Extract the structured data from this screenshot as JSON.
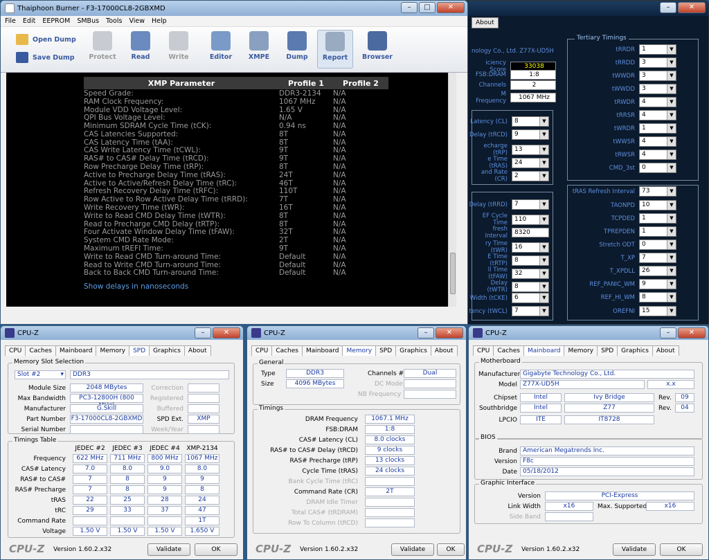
{
  "tp": {
    "title": "Thaiphoon Burner - F3-17000CL8-2GBXMD",
    "menu": [
      "File",
      "Edit",
      "EEPROM",
      "SMBus",
      "Tools",
      "View",
      "Help"
    ],
    "open_dump": "Open Dump",
    "save_dump": "Save Dump",
    "buttons": [
      "Protect",
      "Read",
      "Write",
      "Editor",
      "XMPE",
      "Dump",
      "Report",
      "Browser"
    ],
    "headers": [
      "XMP Parameter",
      "Profile 1",
      "Profile 2"
    ],
    "rows": [
      [
        "Speed Grade:",
        "DDR3-2134",
        "N/A"
      ],
      [
        "RAM Clock Frequency:",
        "1067 MHz",
        "N/A"
      ],
      [
        "Module VDD Voltage Level:",
        "1.65 V",
        "N/A"
      ],
      [
        "QPI Bus Voltage Level:",
        "N/A",
        "N/A"
      ],
      [
        "Minimum SDRAM Cycle Time (tCK):",
        "0.94 ns",
        "N/A"
      ],
      [
        "CAS Latencies Supported:",
        "8T",
        "N/A"
      ],
      [
        "CAS Latency Time (tAA):",
        "8T",
        "N/A"
      ],
      [
        "CAS Write Latency Time (tCWL):",
        "9T",
        "N/A"
      ],
      [
        "RAS# to CAS# Delay Time (tRCD):",
        "9T",
        "N/A"
      ],
      [
        "Row Precharge Delay Time (tRP):",
        "8T",
        "N/A"
      ],
      [
        "Active to Precharge Delay Time (tRAS):",
        "24T",
        "N/A"
      ],
      [
        "Active to Active/Refresh Delay Time (tRC):",
        "46T",
        "N/A"
      ],
      [
        "Refresh Recovery Delay Time (tRFC):",
        "110T",
        "N/A"
      ],
      [
        "Row Active to Row Active Delay Time (tRRD):",
        "7T",
        "N/A"
      ],
      [
        "Write Recovery Time (tWR):",
        "16T",
        "N/A"
      ],
      [
        "Write to Read CMD Delay Time (tWTR):",
        "8T",
        "N/A"
      ],
      [
        "Read to Precharge CMD Delay (tRTP):",
        "8T",
        "N/A"
      ],
      [
        "Four Activate Window Delay Time (tFAW):",
        "32T",
        "N/A"
      ],
      [
        "System CMD Rate Mode:",
        "2T",
        "N/A"
      ],
      [
        "Maximum tREFI Time:",
        "9T",
        "N/A"
      ],
      [
        "Write to Read CMD Turn-around Time:",
        "Default",
        "N/A"
      ],
      [
        "Read to Write CMD Turn-around Time:",
        "Default",
        "N/A"
      ],
      [
        "Back to Back CMD Turn-around Time:",
        "Default",
        "N/A"
      ]
    ],
    "link": "Show delays in nanoseconds"
  },
  "dk": {
    "tab": "About",
    "co": "nology Co., Ltd.  Z77X-UD5H",
    "info": [
      [
        "iciency Score",
        "33038"
      ],
      [
        "FSB:DRAM",
        "1:8"
      ],
      [
        "Channels",
        "2"
      ],
      [
        "M Frequency",
        "1067 MHz"
      ]
    ],
    "primary": [
      [
        "Latency (CL)",
        "8"
      ],
      [
        "Delay (tRCD)",
        "9"
      ],
      [
        "echarge (tRP)",
        "13"
      ],
      [
        "e Time (tRAS)",
        "24"
      ],
      [
        "and Rate (CR)",
        "2"
      ]
    ],
    "secondary": [
      [
        "Delay (tRRD)",
        "7"
      ],
      [
        "EF Cycle Time",
        "110"
      ],
      [
        "fresh Interval",
        "8320"
      ],
      [
        "ry Time (tWR)",
        "16"
      ],
      [
        "E Time (tRTP)",
        "8"
      ],
      [
        "ll Time (tFAW)",
        "32"
      ],
      [
        "Delay (tWTR)",
        "8"
      ],
      [
        "Width (tCKE)",
        "6"
      ],
      [
        "tency (tWCL)",
        "7"
      ]
    ],
    "tert_caption": "Tertiary Timings",
    "tertiary": [
      [
        "tRRDR",
        "1"
      ],
      [
        "tRRDD",
        "3"
      ],
      [
        "tWWDR",
        "3"
      ],
      [
        "tWWDD",
        "3"
      ],
      [
        "tRWDR",
        "4"
      ],
      [
        "tRRSR",
        "4"
      ],
      [
        "tWRDR",
        "1"
      ],
      [
        "tWWSR",
        "4"
      ],
      [
        "tRWSR",
        "4"
      ],
      [
        "CMD_3st",
        "0"
      ]
    ],
    "misc": [
      [
        "tRAS Refresh Interval",
        "73"
      ],
      [
        "TAONPD",
        "10"
      ],
      [
        "TCPDED",
        "1"
      ],
      [
        "TPREPDEN",
        "1"
      ],
      [
        "Stretch ODT",
        "0"
      ],
      [
        "T_XP",
        "7"
      ],
      [
        "T_XPDLL",
        "26"
      ],
      [
        "REF_PANIC_WM",
        "9"
      ],
      [
        "REF_HI_WM",
        "8"
      ],
      [
        "OREFNI",
        "15"
      ]
    ]
  },
  "cz_tabs": [
    "CPU",
    "Caches",
    "Mainboard",
    "Memory",
    "SPD",
    "Graphics",
    "About"
  ],
  "cz_title": "CPU-Z",
  "cz_logo": "CPU-Z",
  "cz_version": "Version 1.60.2.x32",
  "validate": "Validate",
  "ok": "OK",
  "spd": {
    "slot_caption": "Memory Slot Selection",
    "slot": "Slot #2",
    "type": "DDR3",
    "left": [
      [
        "Module Size",
        "2048 MBytes"
      ],
      [
        "Max Bandwidth",
        "PC3-12800H (800 MHz)"
      ],
      [
        "Manufacturer",
        "G.Skill"
      ],
      [
        "Part Number",
        "F3-17000CL8-2GBXMD"
      ],
      [
        "Serial Number",
        ""
      ]
    ],
    "right": [
      [
        "Correction",
        ""
      ],
      [
        "Registered",
        ""
      ],
      [
        "Buffered",
        ""
      ],
      [
        "SPD Ext.",
        "XMP"
      ],
      [
        "Week/Year",
        ""
      ]
    ],
    "tt_caption": "Timings Table",
    "cols": [
      "JEDEC #2",
      "JEDEC #3",
      "JEDEC #4",
      "XMP-2134"
    ],
    "trows": [
      [
        "Frequency",
        "622 MHz",
        "711 MHz",
        "800 MHz",
        "1067 MHz"
      ],
      [
        "CAS# Latency",
        "7.0",
        "8.0",
        "9.0",
        "8.0"
      ],
      [
        "RAS# to CAS#",
        "7",
        "8",
        "9",
        "9"
      ],
      [
        "RAS# Precharge",
        "7",
        "8",
        "9",
        "8"
      ],
      [
        "tRAS",
        "22",
        "25",
        "28",
        "24"
      ],
      [
        "tRC",
        "29",
        "33",
        "37",
        "47"
      ],
      [
        "Command Rate",
        "",
        "",
        "",
        "1T"
      ],
      [
        "Voltage",
        "1.50 V",
        "1.50 V",
        "1.50 V",
        "1.650 V"
      ]
    ]
  },
  "mem": {
    "gen_caption": "General",
    "type_l": "Type",
    "type": "DDR3",
    "size_l": "Size",
    "size": "4096 MBytes",
    "ch_l": "Channels #",
    "ch": "Dual",
    "dc_l": "DC Mode",
    "nb_l": "NB Frequency",
    "tim_caption": "Timings",
    "rows": [
      [
        "DRAM Frequency",
        "1067.1 MHz",
        1
      ],
      [
        "FSB:DRAM",
        "1:8",
        1
      ],
      [
        "CAS# Latency (CL)",
        "8.0 clocks",
        1
      ],
      [
        "RAS# to CAS# Delay (tRCD)",
        "9 clocks",
        1
      ],
      [
        "RAS# Precharge (tRP)",
        "13 clocks",
        1
      ],
      [
        "Cycle Time (tRAS)",
        "24 clocks",
        1
      ],
      [
        "Bank Cycle Time (tRC)",
        "",
        0
      ],
      [
        "Command Rate (CR)",
        "2T",
        1
      ],
      [
        "DRAM Idle Timer",
        "",
        0
      ],
      [
        "Total CAS# (tRDRAM)",
        "",
        0
      ],
      [
        "Row To Column (tRCD)",
        "",
        0
      ]
    ]
  },
  "mb": {
    "mb_caption": "Motherboard",
    "manuf_l": "Manufacturer",
    "manuf": "Gigabyte Technology Co., Ltd.",
    "model_l": "Model",
    "model": "Z77X-UD5H",
    "model_rev": "x.x",
    "chipset_l": "Chipset",
    "chipset": "Intel",
    "chipset2": "Ivy Bridge",
    "rev_l": "Rev.",
    "chipset_rev": "09",
    "south_l": "Southbridge",
    "south": "Intel",
    "south2": "Z77",
    "south_rev": "04",
    "lpcio_l": "LPCIO",
    "lpcio": "ITE",
    "lpcio2": "IT8728",
    "bios_caption": "BIOS",
    "brand_l": "Brand",
    "brand": "American Megatrends Inc.",
    "ver_l": "Version",
    "ver": "F8c",
    "date_l": "Date",
    "date": "05/18/2012",
    "gi_caption": "Graphic Interface",
    "gver_l": "Version",
    "gver": "PCI-Express",
    "lw_l": "Link Width",
    "lw": "x16",
    "ms_l": "Max. Supported",
    "ms": "x16",
    "sb_l": "Side Band"
  }
}
